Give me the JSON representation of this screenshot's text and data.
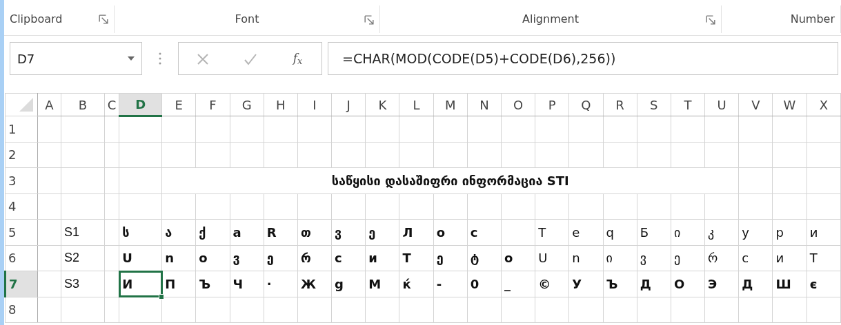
{
  "ribbon_groups": [
    {
      "label": "Clipboard",
      "launcher": true
    },
    {
      "label": "Font",
      "launcher": true
    },
    {
      "label": "Alignment",
      "launcher": true
    },
    {
      "label": "Number",
      "launcher": false
    }
  ],
  "name_box": {
    "value": "D7"
  },
  "formula_buttons": [
    {
      "kind": "cancel",
      "disabled": true
    },
    {
      "kind": "enter",
      "disabled": true
    },
    {
      "kind": "function",
      "label": "f$_{x}$",
      "disabled": false
    }
  ],
  "formula_bar": {
    "value": "=CHAR(MOD(CODE(D5)+CODE(D6),256))"
  },
  "columns": [
    {
      "label": "A",
      "selected": false
    },
    {
      "label": "B",
      "selected": false
    },
    {
      "label": "C",
      "selected": false
    },
    {
      "label": "D",
      "selected": true
    },
    {
      "label": "E",
      "selected": false
    },
    {
      "label": "F",
      "selected": false
    },
    {
      "label": "G",
      "selected": false
    },
    {
      "label": "H",
      "selected": false
    },
    {
      "label": "I",
      "selected": false
    },
    {
      "label": "J",
      "selected": false
    },
    {
      "label": "K",
      "selected": false
    },
    {
      "label": "L",
      "selected": false
    },
    {
      "label": "M",
      "selected": false
    },
    {
      "label": "N",
      "selected": false
    },
    {
      "label": "O",
      "selected": false
    },
    {
      "label": "P",
      "selected": false
    },
    {
      "label": "Q",
      "selected": false
    },
    {
      "label": "R",
      "selected": false
    },
    {
      "label": "S",
      "selected": false
    },
    {
      "label": "T",
      "selected": false
    },
    {
      "label": "U",
      "selected": false
    },
    {
      "label": "V",
      "selected": false
    },
    {
      "label": "W",
      "selected": false
    },
    {
      "label": "X",
      "selected": false
    }
  ],
  "rows": [
    {
      "header": "1",
      "selected": false
    },
    {
      "header": "2",
      "selected": false
    },
    {
      "header": "3",
      "selected": false,
      "title": {
        "text": "საწყისი  დასაშიფრი ინფორმაცია STI",
        "bold": true
      }
    },
    {
      "header": "4",
      "selected": false
    },
    {
      "header": "5",
      "selected": false,
      "label": "S1",
      "cells": [
        {
          "text": "ს",
          "bold": true,
          "selected": false
        },
        {
          "text": "ა",
          "bold": true,
          "selected": false
        },
        {
          "text": "ქ",
          "bold": true,
          "selected": false
        },
        {
          "text": "a",
          "bold": true,
          "selected": false
        },
        {
          "text": "R",
          "bold": true,
          "selected": false
        },
        {
          "text": "თ",
          "bold": true,
          "selected": false
        },
        {
          "text": "ვ",
          "bold": true,
          "selected": false
        },
        {
          "text": "ე",
          "bold": true,
          "selected": false
        },
        {
          "text": "Л",
          "bold": true,
          "selected": false
        },
        {
          "text": "o",
          "bold": true,
          "selected": false
        },
        {
          "text": "c",
          "bold": true,
          "selected": false
        },
        {
          "selected": false
        },
        {
          "text": "T",
          "bold": false,
          "selected": false
        },
        {
          "text": "e",
          "bold": false,
          "selected": false
        },
        {
          "text": "q",
          "bold": false,
          "selected": false
        },
        {
          "text": "Б",
          "bold": false,
          "selected": false
        },
        {
          "text": "ი",
          "bold": false,
          "selected": false
        },
        {
          "text": "კ",
          "bold": false,
          "selected": false
        },
        {
          "text": "y",
          "bold": false,
          "selected": false
        },
        {
          "text": "p",
          "bold": false,
          "selected": false
        },
        {
          "text": "и",
          "bold": false,
          "selected": false
        }
      ]
    },
    {
      "header": "6",
      "selected": false,
      "label": "S2",
      "cells": [
        {
          "text": "U",
          "bold": true,
          "selected": false
        },
        {
          "text": "n",
          "bold": true,
          "selected": false
        },
        {
          "text": "o",
          "bold": true,
          "selected": false
        },
        {
          "text": "ვ",
          "bold": true,
          "selected": false
        },
        {
          "text": "ე",
          "bold": true,
          "selected": false
        },
        {
          "text": "რ",
          "bold": true,
          "selected": false
        },
        {
          "text": "c",
          "bold": true,
          "selected": false
        },
        {
          "text": "и",
          "bold": true,
          "selected": false
        },
        {
          "text": "T",
          "bold": true,
          "selected": false
        },
        {
          "text": "ე",
          "bold": true,
          "selected": false
        },
        {
          "text": "ტ",
          "bold": true,
          "selected": false
        },
        {
          "text": "o",
          "bold": true,
          "selected": false
        },
        {
          "text": "U",
          "bold": false,
          "selected": false
        },
        {
          "text": "n",
          "bold": false,
          "selected": false
        },
        {
          "text": "ი",
          "bold": false,
          "selected": false
        },
        {
          "text": "ვ",
          "bold": false,
          "selected": false
        },
        {
          "text": "ე",
          "bold": false,
          "selected": false
        },
        {
          "text": "რ",
          "bold": false,
          "selected": false
        },
        {
          "text": "c",
          "bold": false,
          "selected": false
        },
        {
          "text": "и",
          "bold": false,
          "selected": false
        },
        {
          "text": "T",
          "bold": false,
          "selected": false
        }
      ]
    },
    {
      "header": "7",
      "selected": true,
      "label": "S3",
      "cells": [
        {
          "text": "И",
          "bold": true,
          "selected": true
        },
        {
          "text": "П",
          "bold": true,
          "selected": false
        },
        {
          "text": "Ъ",
          "bold": true,
          "selected": false
        },
        {
          "text": "Ч",
          "bold": true,
          "selected": false
        },
        {
          "text": "·",
          "bold": true,
          "selected": false
        },
        {
          "text": "Ж",
          "bold": true,
          "selected": false
        },
        {
          "text": "g",
          "bold": true,
          "selected": false
        },
        {
          "text": "М",
          "bold": true,
          "selected": false
        },
        {
          "text": "ќ",
          "bold": true,
          "selected": false
        },
        {
          "text": "-",
          "bold": true,
          "selected": false
        },
        {
          "text": "0",
          "bold": true,
          "selected": false
        },
        {
          "text": "_",
          "bold": true,
          "selected": false
        },
        {
          "text": "©",
          "bold": true,
          "selected": false
        },
        {
          "text": "У",
          "bold": true,
          "selected": false
        },
        {
          "text": "Ъ",
          "bold": true,
          "selected": false
        },
        {
          "text": "Д",
          "bold": true,
          "selected": false
        },
        {
          "text": "О",
          "bold": true,
          "selected": false
        },
        {
          "text": "Э",
          "bold": true,
          "selected": false
        },
        {
          "text": "Д",
          "bold": true,
          "selected": false
        },
        {
          "text": "Ш",
          "bold": true,
          "selected": false
        },
        {
          "text": "є",
          "bold": true,
          "selected": false
        }
      ]
    },
    {
      "header": "8",
      "selected": false
    }
  ]
}
